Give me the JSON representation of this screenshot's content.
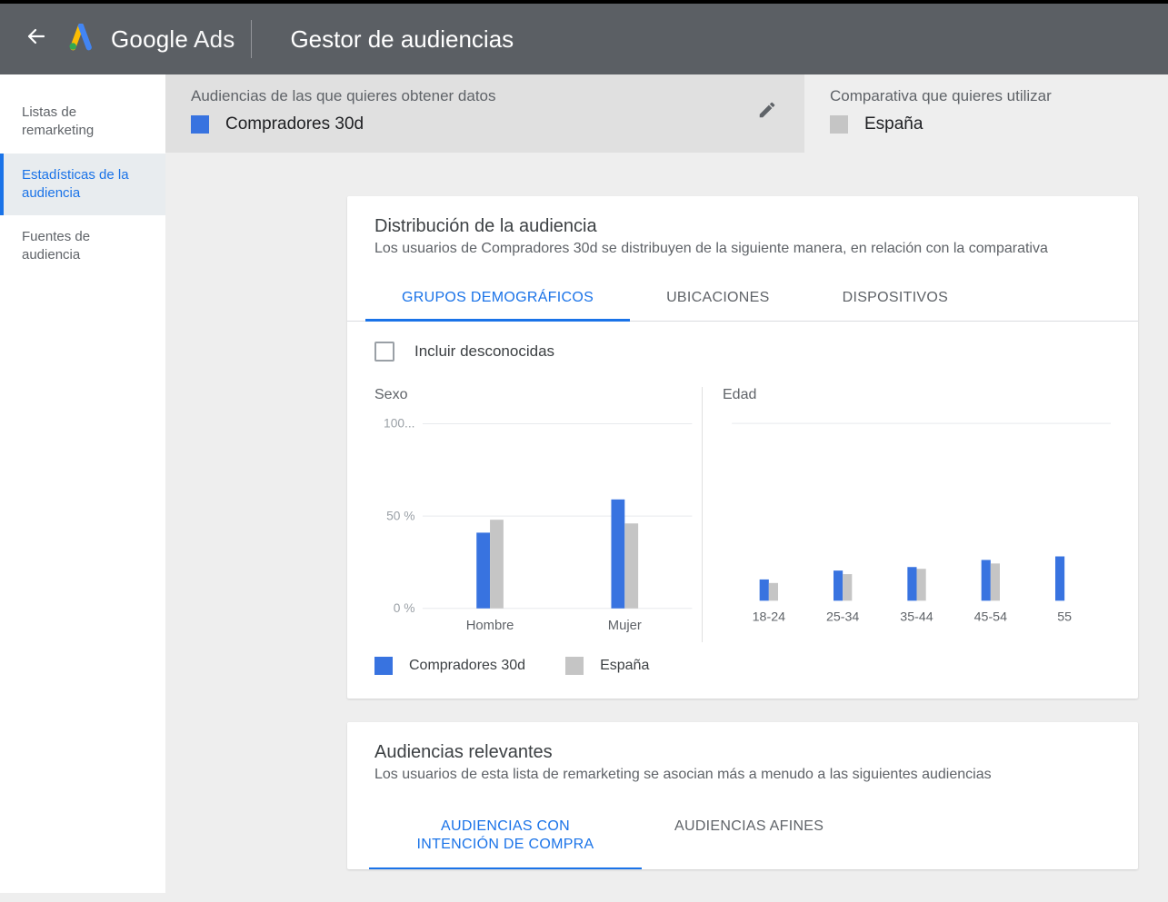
{
  "header": {
    "brand1": "Google",
    "brand2": " Ads",
    "page_title": "Gestor de audiencias"
  },
  "sidebar": {
    "items": [
      "Listas de remarketing",
      "Estadísticas de la audiencia",
      "Fuentes de audiencia"
    ]
  },
  "selector": {
    "left_label": "Audiencias de las que quieres obtener datos",
    "left_value": "Compradores 30d",
    "right_label": "Comparativa que quieres utilizar",
    "right_value": "España"
  },
  "dist_card": {
    "title": "Distribución de la audiencia",
    "subtitle": "Los usuarios de Compradores 30d se distribuyen de la siguiente manera, en relación con la comparativa",
    "tabs": [
      "GRUPOS DEMOGRÁFICOS",
      "UBICACIONES",
      "DISPOSITIVOS"
    ],
    "checkbox_label": "Incluir desconocidas",
    "chart1_title": "Sexo",
    "chart2_title": "Edad",
    "axis_labels": {
      "y0": "0 %",
      "y50": "50 %",
      "y100": "100..."
    },
    "legend": [
      "Compradores 30d",
      "España"
    ]
  },
  "relevant_card": {
    "title": "Audiencias relevantes",
    "subtitle": "Los usuarios de esta lista de remarketing se asocian más a menudo a las siguientes audiencias",
    "tabs": [
      "AUDIENCIAS CON INTENCIÓN DE COMPRA",
      "AUDIENCIAS AFINES"
    ]
  },
  "chart_data": [
    {
      "type": "bar",
      "title": "Sexo",
      "ylabel": "%",
      "ylim": [
        0,
        100
      ],
      "categories": [
        "Hombre",
        "Mujer"
      ],
      "series": [
        {
          "name": "Compradores 30d",
          "values": [
            41,
            59
          ]
        },
        {
          "name": "España",
          "values": [
            48,
            46
          ]
        }
      ]
    },
    {
      "type": "bar",
      "title": "Edad",
      "ylabel": "%",
      "ylim": [
        0,
        100
      ],
      "categories": [
        "18-24",
        "25-34",
        "35-44",
        "45-54",
        "55"
      ],
      "series": [
        {
          "name": "Compradores 30d",
          "values": [
            12,
            17,
            19,
            23,
            25
          ]
        },
        {
          "name": "España",
          "values": [
            10,
            15,
            18,
            21,
            0
          ]
        }
      ]
    }
  ]
}
